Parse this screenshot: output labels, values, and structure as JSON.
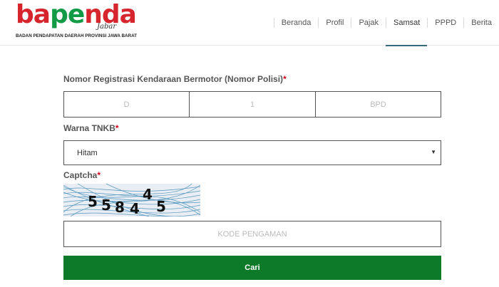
{
  "brand": {
    "logo_word": "bapenda",
    "logo_sub": "Jabar",
    "tagline": "BADAN PENDAPATAN DAERAH PROVINSI JAWA BARAT",
    "colors": {
      "red": "#d6252c",
      "green": "#129a47"
    }
  },
  "nav": {
    "items": [
      {
        "label": "Beranda"
      },
      {
        "label": "Profil"
      },
      {
        "label": "Pajak"
      },
      {
        "label": "Samsat",
        "active": true
      },
      {
        "label": "PPPD"
      },
      {
        "label": "Berita"
      }
    ]
  },
  "form": {
    "plate_label": "Nomor Registrasi Kendaraan Bermotor (Nomor Polisi)",
    "plate_prefix_placeholder": "D",
    "plate_number_placeholder": "1",
    "plate_suffix_placeholder": "BPD",
    "tnkb_label": "Warna TNKB",
    "tnkb_value": "Hitam",
    "captcha_label": "Captcha",
    "captcha_code": [
      "5",
      "5",
      "8",
      "4",
      "4",
      "5"
    ],
    "required_mark": "*",
    "security_placeholder": "KODE PENGAMAN",
    "submit_label": "Cari",
    "colors": {
      "button": "#0c7a29",
      "required": "#d0021b"
    }
  }
}
